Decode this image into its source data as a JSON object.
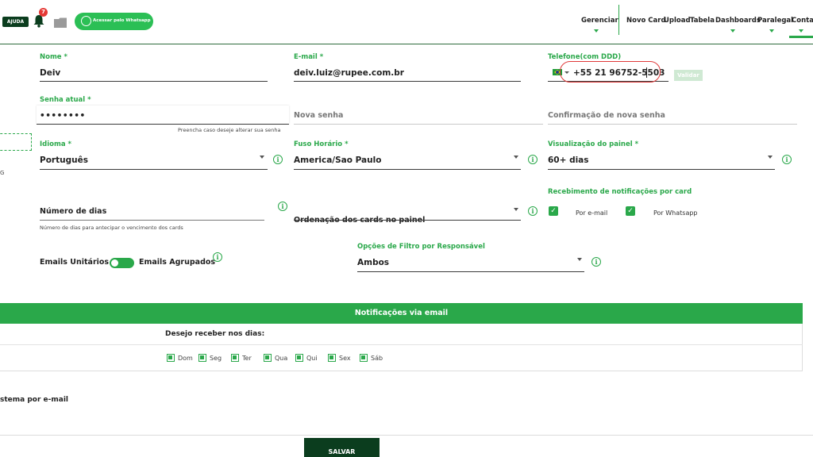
{
  "topbar": {
    "help_label": "AJUDA",
    "notif_count": "7",
    "whatsapp_label": "Acessar pelo Whatsapp",
    "nav": [
      {
        "label": "Gerenciar"
      },
      {
        "label": "Novo Card"
      },
      {
        "label": "Upload"
      },
      {
        "label": "Tabela"
      },
      {
        "label": "Dashboards"
      },
      {
        "label": "Paralegal"
      },
      {
        "label": "Conta"
      }
    ]
  },
  "form": {
    "nome": {
      "label": "Nome *",
      "value": "Deiv"
    },
    "email": {
      "label": "E-mail *",
      "value": "deiv.luiz@rupee.com.br"
    },
    "telefone": {
      "label": "Telefone(com DDD)",
      "value": "+55 21 96752-5503",
      "validate_label": "Validar"
    },
    "senha_atual": {
      "label": "Senha atual *",
      "value": "••••••••",
      "hint": "Preencha caso deseje alterar sua senha"
    },
    "nova_senha": {
      "placeholder": "Nova senha"
    },
    "confirmacao": {
      "placeholder": "Confirmação de nova senha"
    },
    "idioma": {
      "label": "Idioma *",
      "value": "Português"
    },
    "fuso": {
      "label": "Fuso Horário *",
      "value": "America/Sao Paulo"
    },
    "visualizacao": {
      "label": "Visualização do painel *",
      "value": "60+ dias"
    },
    "dias": {
      "placeholder": "Número de dias",
      "hint": "Número de dias para antecipar o vencimento dos cards"
    },
    "ordenacao": {
      "placeholder": "Ordenação dos cards no painel"
    },
    "recebimento": {
      "label": "Recebimento de notificações por card",
      "email_label": "Por e-mail",
      "whatsapp_label": "Por Whatsapp"
    },
    "emails_unitarios": "Emails Unitários",
    "emails_agrupados": "Emails Agrupados",
    "filtro": {
      "label": "Opções de Filtro por Responsável",
      "value": "Ambos"
    },
    "left_stub": "G"
  },
  "notificacoes": {
    "title": "Notificações via email",
    "days_heading": "Desejo receber nos dias:",
    "days": [
      "Dom",
      "Seg",
      "Ter",
      "Qua",
      "Qui",
      "Sex",
      "Sáb"
    ]
  },
  "sistema_label": "stema por e-mail",
  "save_label": "SALVAR",
  "colors": {
    "accent": "#2aa84a",
    "dark": "#0b3d1e",
    "highlight": "#e03a3a"
  }
}
